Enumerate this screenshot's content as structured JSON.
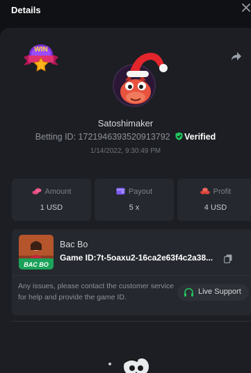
{
  "header": {
    "title": "Details",
    "close_icon": "close-icon"
  },
  "user": {
    "name": "Satoshimaker",
    "betting_id_label": "Betting ID:",
    "betting_id": "1721946393520913792",
    "verified_label": "Verified",
    "datetime": "1/14/2022, 9:30:49 PM"
  },
  "stats": [
    {
      "label": "Amount",
      "value": "1 USD",
      "icon": "coins-icon"
    },
    {
      "label": "Payout",
      "value": "5 x",
      "icon": "wallet-icon"
    },
    {
      "label": "Profit",
      "value": "4 USD",
      "icon": "profit-icon"
    }
  ],
  "game": {
    "name": "Bac Bo",
    "game_id_label": "Game ID:",
    "game_id": "7t-5oaxu2-16ca2e63f4c2a38...",
    "thumb_text": "BAC BO",
    "notice": "Any issues, please contact the customer service for help and provide the game ID.",
    "support_label": "Live Support"
  },
  "badge_text": "WIN",
  "colors": {
    "verified": "#22c55e",
    "support_icon": "#22c55e",
    "amount_icon": "#e64a7d",
    "payout_icon": "#7b5cff",
    "profit_icon": "#e0433a"
  }
}
